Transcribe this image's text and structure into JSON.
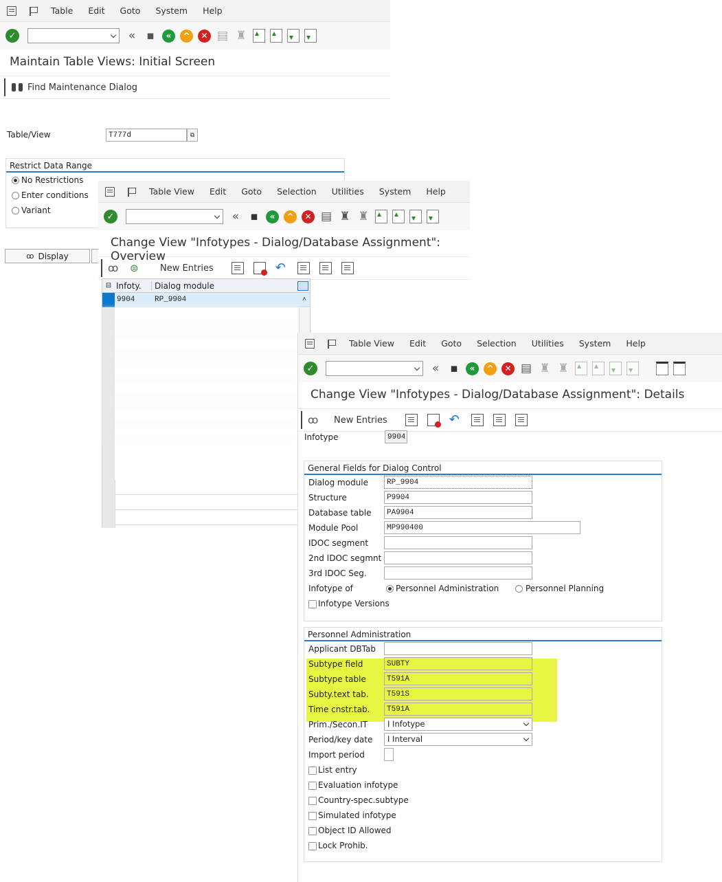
{
  "w1": {
    "menu": [
      "Table",
      "Edit",
      "Goto",
      "System",
      "Help"
    ],
    "title": "Maintain Table Views: Initial Screen",
    "find_label": "Find Maintenance Dialog",
    "table_view_label": "Table/View",
    "table_view_value": "T777d",
    "restrict_title": "Restrict Data Range",
    "radio_none": "No Restrictions",
    "radio_cond": "Enter conditions",
    "radio_variant": "Variant",
    "display_label": "Display"
  },
  "w2": {
    "menu": [
      "Table View",
      "Edit",
      "Goto",
      "Selection",
      "Utilities",
      "System",
      "Help"
    ],
    "title": "Change View \"Infotypes - Dialog/Database Assignment\": Overview",
    "new_entries": "New Entries",
    "col_infotype": "Infoty.",
    "col_dialog": "Dialog module",
    "row1_infotype": "9904",
    "row1_dialog": "RP_9904"
  },
  "w3": {
    "menu": [
      "Table View",
      "Edit",
      "Goto",
      "Selection",
      "Utilities",
      "System",
      "Help"
    ],
    "title": "Change View \"Infotypes - Dialog/Database Assignment\": Details",
    "new_entries": "New Entries",
    "infotype_label": "Infotype",
    "infotype_value": "9904",
    "general": {
      "title": "General Fields for Dialog Control",
      "dialog_module_label": "Dialog module",
      "dialog_module": "RP_9904",
      "structure_label": "Structure",
      "structure": "P9904",
      "db_table_label": "Database table",
      "db_table": "PA9904",
      "module_pool_label": "Module Pool",
      "module_pool": "MP990400",
      "idoc_label": "IDOC segment",
      "idoc": "",
      "idoc2_label": "2nd IDOC segmnt",
      "idoc2": "",
      "idoc3_label": "3rd IDOC Seg.",
      "idoc3": "",
      "infotype_of_label": "Infotype of",
      "pa_label": "Personnel Administration",
      "pp_label": "Personnel Planning",
      "versions_label": "Infotype Versions"
    },
    "pa": {
      "title": "Personnel Administration",
      "applicant_label": "Applicant DBTab",
      "applicant": "",
      "subtype_field_label": "Subtype field",
      "subtype_field": "SUBTY",
      "subtype_table_label": "Subtype table",
      "subtype_table": "T591A",
      "subty_text_label": "Subty.text tab.",
      "subty_text": "T591S",
      "time_cnstr_label": "Time cnstr.tab.",
      "time_cnstr": "T591A",
      "prim_label": "Prim./Secon.IT",
      "prim": "I Infotype",
      "period_label": "Period/key date",
      "period": "I Interval",
      "import_label": "Import period",
      "list_entry": "List entry",
      "eval_infotype": "Evaluation infotype",
      "country_spec": "Country-spec.subtype",
      "simulated": "Simulated infotype",
      "object_id": "Object ID Allowed",
      "lock_prohib": "Lock Prohib."
    }
  },
  "colors": {
    "highlight": "#e6f542",
    "accent": "#2a7acb",
    "ok_green": "#2e8b2e"
  }
}
